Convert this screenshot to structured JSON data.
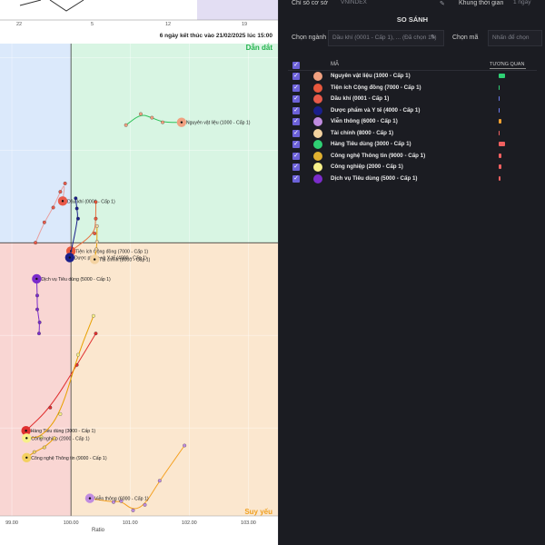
{
  "chart": {
    "mini_ticks": [
      "22",
      "5",
      "12",
      "19"
    ],
    "window_note": "6 ngày kết thúc vào 21/02/2025 lúc 15:00",
    "quadrants": {
      "top_right": "Dẫn dắt",
      "bottom_right": "Suy yếu"
    },
    "x_axis_title": "Ratio"
  },
  "chart_data": {
    "type": "scatter",
    "xlabel": "Ratio",
    "x_ticks": [
      "99.00",
      "100.00",
      "101.00",
      "102.00",
      "103.00"
    ],
    "xlim": [
      98.8,
      103.5
    ],
    "ylim": [
      97.05,
      102.15
    ],
    "series": [
      {
        "name": "Nguyên vật liệu (1000 - Cấp 1)",
        "color": "#f0a080",
        "tail": "#2fc25a",
        "points": [
          [
            100.93,
            101.27
          ],
          [
            101.18,
            101.39
          ],
          [
            101.37,
            101.35
          ],
          [
            101.55,
            101.3
          ],
          [
            101.87,
            101.3
          ]
        ]
      },
      {
        "name": "Dầu khí (0001 - Cấp 1)",
        "color": "#e85a4a",
        "tail": "#e8a0a0",
        "points": [
          [
            99.4,
            100.0
          ],
          [
            99.55,
            100.22
          ],
          [
            99.7,
            100.38
          ],
          [
            99.82,
            100.55
          ],
          [
            99.9,
            100.64
          ],
          [
            99.86,
            100.45
          ]
        ]
      },
      {
        "name": "Tiện ích Cộng đồng (7000 - Cấp 1)",
        "color": "#e8583d",
        "tail": "#e87040",
        "points": [
          [
            100.42,
            100.44
          ],
          [
            100.42,
            100.26
          ],
          [
            100.4,
            100.1
          ],
          [
            100.0,
            99.91
          ]
        ]
      },
      {
        "name": "Dược phẩm và Y tế (4000 - Cấp 1)",
        "color": "#1a1f8a",
        "tail": "#1a1f8a",
        "points": [
          [
            100.08,
            100.48
          ],
          [
            100.1,
            100.37
          ],
          [
            100.12,
            100.26
          ],
          [
            99.98,
            99.84
          ]
        ]
      },
      {
        "name": "Tài chính (8000 - Cấp 1)",
        "color": "#f3d2a0",
        "tail": "#e8a000",
        "points": [
          [
            100.44,
            100.18
          ],
          [
            100.44,
            100.01
          ],
          [
            100.43,
            99.93
          ],
          [
            100.4,
            99.82
          ]
        ]
      },
      {
        "name": "Dịch vụ Tiêu dùng (5000 - Cấp 1)",
        "color": "#7b2ccb",
        "tail": "#7b2ccb",
        "points": [
          [
            99.46,
            99.02
          ],
          [
            99.47,
            99.14
          ],
          [
            99.43,
            99.28
          ],
          [
            99.43,
            99.43
          ],
          [
            99.42,
            99.61
          ]
        ]
      },
      {
        "name": "Hàng Tiêu dùng (3000 - Cấp 1)",
        "color": "#e03030",
        "tail": "#e03030",
        "points": [
          [
            100.42,
            99.02
          ],
          [
            100.1,
            98.68
          ],
          [
            99.65,
            98.22
          ],
          [
            99.24,
            97.97
          ]
        ]
      },
      {
        "name": "Công nghiệp (2000 - Cấp 1)",
        "color": "#f7f08a",
        "tail": "#e8a000",
        "points": [
          [
            100.38,
            99.21
          ],
          [
            100.12,
            98.79
          ],
          [
            99.82,
            98.15
          ],
          [
            99.5,
            97.9
          ],
          [
            99.25,
            97.89
          ]
        ]
      },
      {
        "name": "Công nghệ Thông tin (9000 - Cấp 1)",
        "color": "#f3d060",
        "tail": "#e8a000",
        "points": [
          [
            99.72,
            97.89
          ],
          [
            99.55,
            97.79
          ],
          [
            99.38,
            97.74
          ],
          [
            99.25,
            97.68
          ]
        ]
      },
      {
        "name": "Viễn thông (6000 - Cấp 1)",
        "color": "#c08ce0",
        "tail": "#f5a020",
        "points": [
          [
            101.92,
            97.81
          ],
          [
            101.5,
            97.43
          ],
          [
            101.25,
            97.17
          ],
          [
            101.05,
            97.11
          ],
          [
            100.85,
            97.21
          ],
          [
            100.72,
            97.2
          ],
          [
            100.32,
            97.24
          ]
        ]
      }
    ]
  },
  "panel": {
    "index_label": "Chỉ số cơ sở",
    "index_value": "VNINDEX",
    "timeframe_label": "Khung thời gian",
    "timeframe_value": "1 ngày",
    "compare_title": "SO SÁNH",
    "sector_label": "Chọn ngành",
    "sector_value": "Dầu khí (0001 - Cấp 1), ... (Đã chọn 10)",
    "code_label": "Chọn mã",
    "code_placeholder": "Nhấn để chọn",
    "col_code": "MÃ",
    "col_corr": "TƯƠNG QUAN"
  },
  "table": [
    {
      "name": "Nguyên vật liệu (1000 - Cấp 1)",
      "color": "#f0a080",
      "bar_color": "#2fd074",
      "bar": 0.3
    },
    {
      "name": "Tiện ích Cộng đồng (7000 - Cấp 1)",
      "color": "#e8583d",
      "bar_color": "#2fd074",
      "bar": 0.05
    },
    {
      "name": "Dầu khí (0001 - Cấp 1)",
      "color": "#e85a4a",
      "bar_color": "#6c7cf0",
      "bar": 0.05
    },
    {
      "name": "Dược phẩm và Y tế (4000 - Cấp 1)",
      "color": "#1a1f8a",
      "bar_color": "#6c7cf0",
      "bar": 0.05
    },
    {
      "name": "Viễn thông (6000 - Cấp 1)",
      "color": "#c08ce0",
      "bar_color": "#f0a030",
      "bar": 0.12
    },
    {
      "name": "Tài chính (8000 - Cấp 1)",
      "color": "#f3d2a0",
      "bar_color": "#f06060",
      "bar": 0.06
    },
    {
      "name": "Hàng Tiêu dùng (3000 - Cấp 1)",
      "color": "#2fd074",
      "bar_color": "#f06060",
      "bar": 0.32
    },
    {
      "name": "Công nghệ Thông tin (9000 - Cấp 1)",
      "color": "#e0b030",
      "bar_color": "#f06060",
      "bar": 0.12
    },
    {
      "name": "Công nghiệp (2000 - Cấp 1)",
      "color": "#f7f08a",
      "bar_color": "#f06060",
      "bar": 0.12
    },
    {
      "name": "Dịch vụ Tiêu dùng (5000 - Cấp 1)",
      "color": "#7b2ccb",
      "bar_color": "#f06060",
      "bar": 0.1
    }
  ]
}
